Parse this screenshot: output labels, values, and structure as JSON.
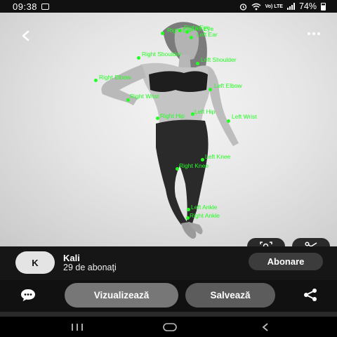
{
  "status_bar": {
    "time": "09:38",
    "network": "Vo) LTE",
    "battery": "74%",
    "battery_level": 0.74,
    "icons": [
      "gallery-icon",
      "alarm-icon",
      "wifi-icon",
      "signal-icon",
      "battery-icon"
    ]
  },
  "keypoints": [
    {
      "label": "Right Eye"
    },
    {
      "label": "Left Eye"
    },
    {
      "label": "Right Ear"
    },
    {
      "label": "Left Ear"
    },
    {
      "label": "Right Shoulder"
    },
    {
      "label": "Left Shoulder"
    },
    {
      "label": "Right Elbow"
    },
    {
      "label": "Left Elbow"
    },
    {
      "label": "Right Wrist"
    },
    {
      "label": "Left Wrist"
    },
    {
      "label": "Right Hip"
    },
    {
      "label": "Left Hip"
    },
    {
      "label": "Left Knee"
    },
    {
      "label": "Right Knee"
    },
    {
      "label": "Left Ankle"
    },
    {
      "label": "Right Ankle"
    }
  ],
  "keypoint_color": "#22ff22",
  "creator": {
    "avatar_letter": "K",
    "name": "Kali",
    "subscribers": "29 de abonaţi",
    "subscribe_label": "Abonare"
  },
  "actions": {
    "visualize_label": "Vizualizează",
    "save_label": "Salvează"
  },
  "icons": {
    "back": "back-arrow-icon",
    "more": "more-options-icon",
    "lens": "visual-search-icon",
    "crop": "scissors-icon",
    "comment": "comment-icon",
    "share": "share-icon"
  }
}
